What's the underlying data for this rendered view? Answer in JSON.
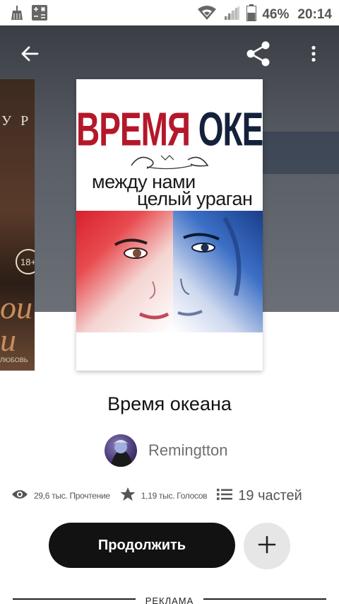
{
  "status_bar": {
    "battery": "46%",
    "time": "20:14",
    "icons": [
      "broom-icon",
      "calculator-icon",
      "wifi-icon",
      "signal-icon",
      "battery-icon"
    ]
  },
  "toolbar": {
    "icons": [
      "back-arrow-icon",
      "share-icon",
      "more-vertical-icon"
    ]
  },
  "peek_book": {
    "title_fragment": "У Р",
    "age_badge": "18+",
    "script_text": "ou\nи",
    "bottom_text": "ЛЮБОВЬ"
  },
  "cover": {
    "title_part1": "ВРЕМЯ ",
    "title_part2": "ОКЕАНА",
    "signature": "Remingtton",
    "subtitle_line1": "между нами",
    "subtitle_line2": "целый ураган"
  },
  "book": {
    "title": "Время океана",
    "author": "Remingtton"
  },
  "stats": {
    "reads": "29,6 тыс. Прочтение",
    "votes": "1,19 тыс. Голосов",
    "parts": "19 частей"
  },
  "actions": {
    "continue_label": "Продолжить"
  },
  "ad": {
    "label": "РЕКЛАМА"
  },
  "colors": {
    "primary_button": "#121212",
    "secondary_button": "#e6e6e6",
    "cover_red": "#b4182a",
    "cover_navy": "#14213b"
  }
}
